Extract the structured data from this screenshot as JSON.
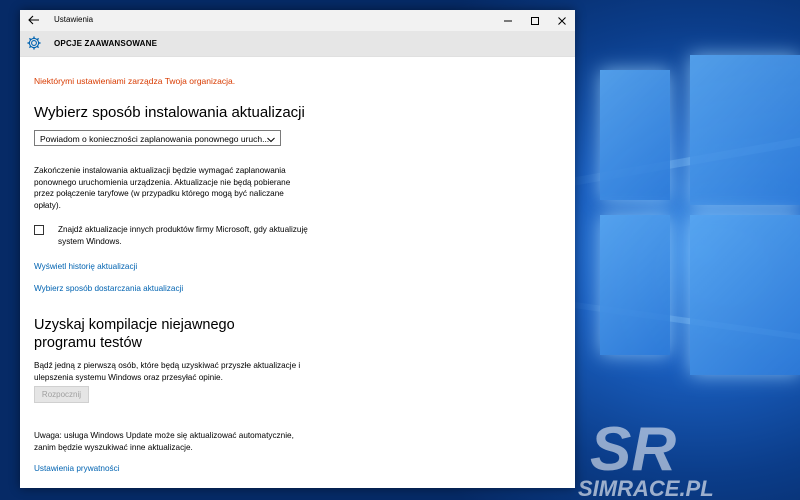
{
  "window": {
    "title": "Ustawienia",
    "back_icon": "arrow-left-icon",
    "controls": [
      "minimize-icon",
      "maximize-icon",
      "close-icon"
    ]
  },
  "header": {
    "icon": "gear-icon",
    "title": "OPCJE ZAAWANSOWANE"
  },
  "main": {
    "notice": "Niektórymi ustawieniami zarządza Twoja organizacja.",
    "install_heading": "Wybierz sposób instalowania aktualizacji",
    "install_dropdown": {
      "selected": "Powiadom o konieczności zaplanowania ponownego uruch...",
      "icon": "chevron-down-icon"
    },
    "install_description": "Zakończenie instalowania aktualizacji będzie wymagać zaplanowania ponownego uruchomienia urządzenia. Aktualizacje nie będą pobierane przez połączenie taryfowe (w przypadku którego mogą być naliczane opłaty).",
    "microsoft_updates_checkbox": {
      "label": "Znajdź aktualizacje innych produktów firmy Microsoft, gdy aktualizuję system Windows.",
      "checked": false
    },
    "history_link": "Wyświetl historię aktualizacji",
    "delivery_link": "Wybierz sposób dostarczania aktualizacji",
    "insider_heading": "Uzyskaj kompilacje niejawnego programu testów",
    "insider_description": "Bądź jedną z pierwszą osób, które będą uzyskiwać przyszłe aktualizacje i ulepszenia systemu Windows oraz przesyłać opinie.",
    "start_button": "Rozpocznij",
    "note": "Uwaga: usługa Windows Update może się aktualizować automatycznie, zanim będzie wyszukiwać inne aktualizacje.",
    "privacy_link": "Ustawienia prywatności"
  },
  "colors": {
    "notice": "#d83b01",
    "link": "#0063b1",
    "titlebar": "#f2f2f2",
    "header": "#e6e6e6"
  },
  "desktop": {
    "wallpaper": "windows-10-hero-wallpaper",
    "watermark_text": "SIMRACE.PL",
    "watermark_logo": "SR"
  }
}
